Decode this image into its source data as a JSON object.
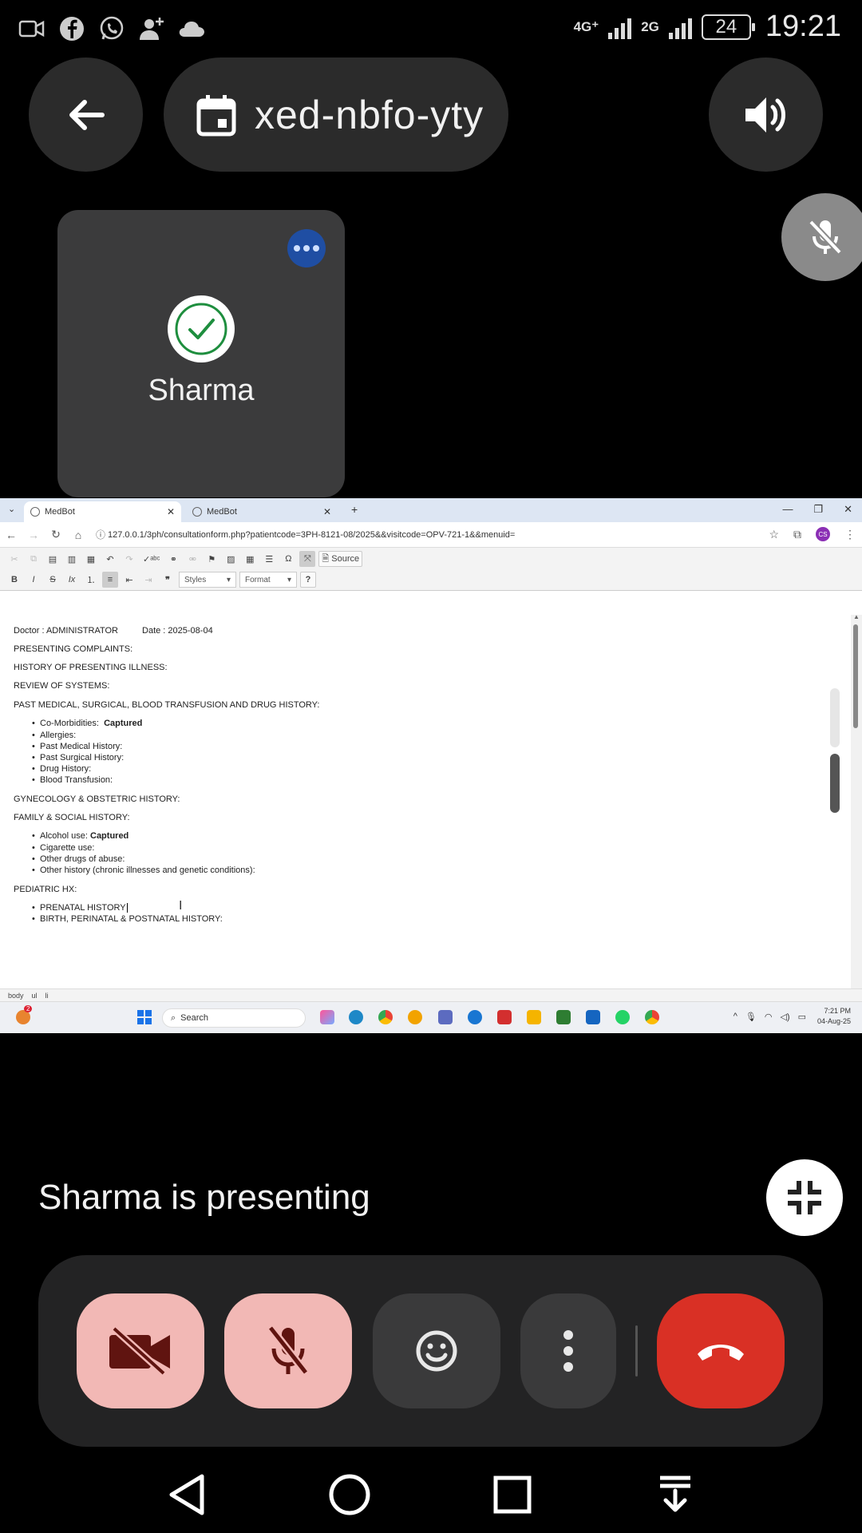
{
  "status_bar": {
    "network_4g": "4G⁺",
    "network_2g": "2G",
    "battery": "24",
    "time": "19:21",
    "icons": [
      "video-icon",
      "facebook-icon",
      "whatsapp-icon",
      "add-contact-icon",
      "cloud-icon"
    ]
  },
  "meet": {
    "meeting_code": "xed-nbfo-yty",
    "participant_name": "Sharma",
    "presenting_text": "Sharma is presenting"
  },
  "browser": {
    "tabs": [
      {
        "label": "MedBot",
        "active": true
      },
      {
        "label": "MedBot",
        "active": false
      }
    ],
    "url": "127.0.0.1/3ph/consultationform.php?patientcode=3PH-8121-08/2025&&visitcode=OPV-721-1&&menuid=",
    "profile_initials": "CS",
    "toolbar": {
      "source_label": "Source",
      "styles_label": "Styles",
      "format_label": "Format",
      "help_label": "?"
    },
    "document": {
      "doctor_line": "Doctor : ADMINISTRATOR",
      "date_line": "Date : 2025-08-04",
      "presenting_complaints": "PRESENTING COMPLAINTS:",
      "history_presenting": "HISTORY OF PRESENTING ILLNESS:",
      "review_systems": "REVIEW OF SYSTEMS:",
      "past_history": "PAST MEDICAL, SURGICAL, BLOOD TRANSFUSION AND DRUG HISTORY:",
      "comorbidities_label": "Co-Morbidities:",
      "comorbidities_value": "Captured",
      "allergies": "Allergies:",
      "past_medical": "Past Medical History:",
      "past_surgical": "Past Surgical History:",
      "drug_history": "Drug History:",
      "blood_transfusion": "Blood Transfusion:",
      "gyn_history": "GYNECOLOGY & OBSTETRIC HISTORY:",
      "family_social": "FAMILY & SOCIAL HISTORY:",
      "alcohol_label": "Alcohol use:",
      "alcohol_value": "Captured",
      "cigarette": "Cigarette use:",
      "other_drugs": "Other drugs of abuse:",
      "other_history": "Other history (chronic illnesses and genetic conditions):",
      "pediatric": "PEDIATRIC HX:",
      "prenatal": "PRENATAL HISTORY",
      "birth": "BIRTH, PERINATAL & POSTNATAL HISTORY:"
    },
    "element_path": [
      "body",
      "ul",
      "li"
    ]
  },
  "taskbar": {
    "search_placeholder": "Search",
    "time": "7:21 PM",
    "date": "04-Aug-25",
    "weather_badge": "2"
  },
  "colors": {
    "hangup": "#d93025",
    "muted_bg": "#f2b8b5",
    "tile_bg": "#3b3b3c",
    "tile_more": "#1f4ea3"
  }
}
